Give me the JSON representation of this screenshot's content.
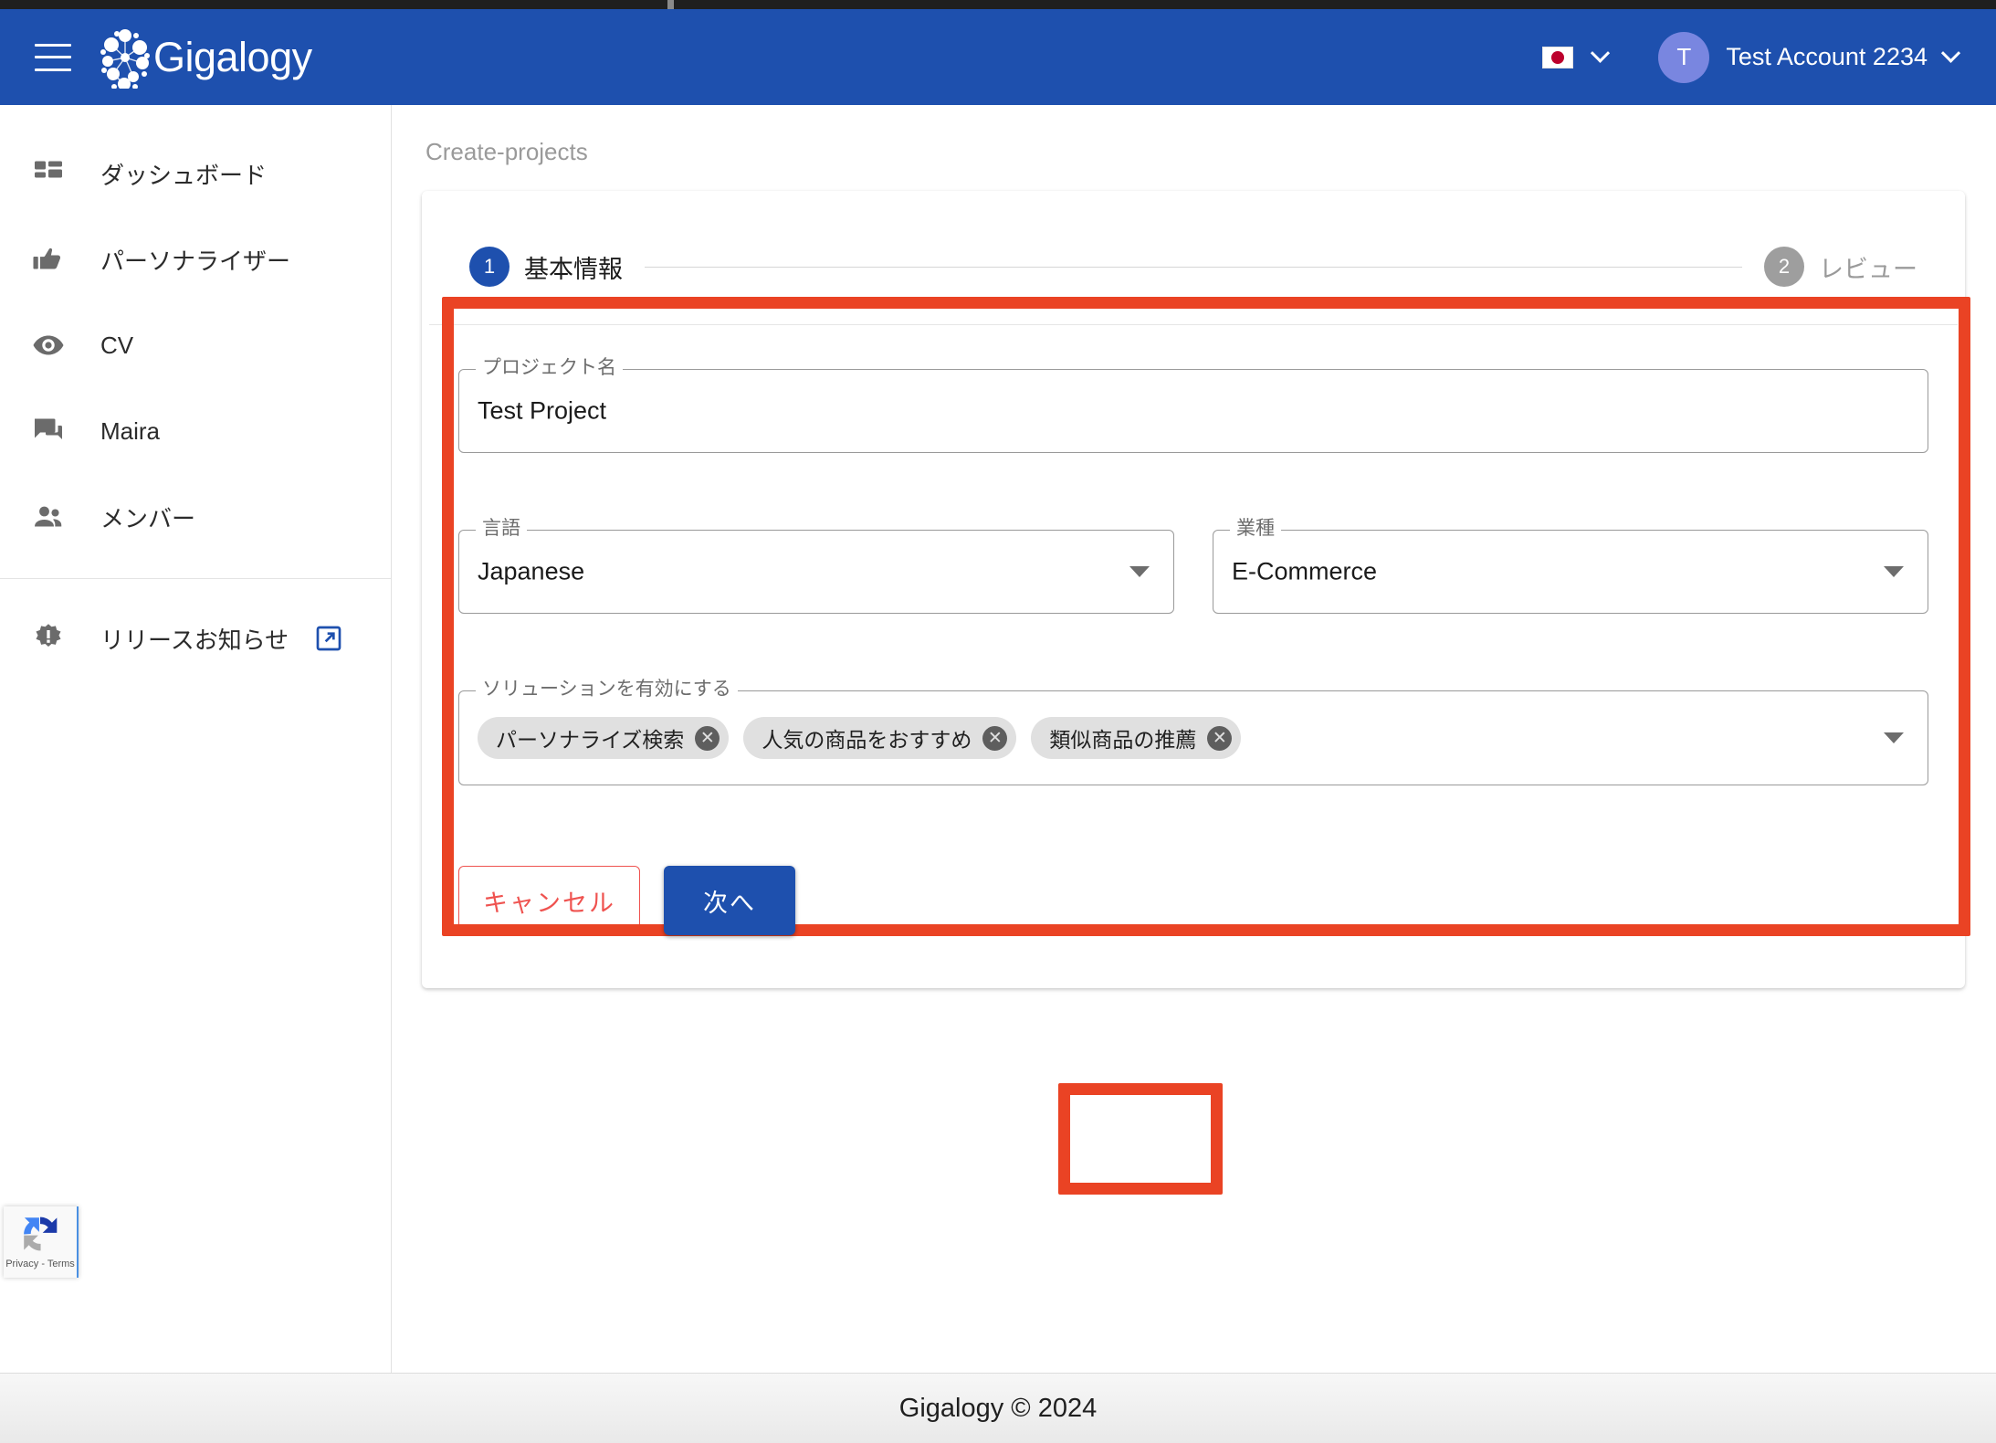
{
  "header": {
    "menu_icon": "hamburger-menu-icon",
    "brand_name": "Gigalogy",
    "language_flag": "japan-flag-icon",
    "account_initial": "T",
    "account_name": "Test Account 2234"
  },
  "sidebar": {
    "items": [
      {
        "label": "ダッシュボード",
        "icon": "dashboard-icon"
      },
      {
        "label": "パーソナライザー",
        "icon": "thumb-up-icon"
      },
      {
        "label": "CV",
        "icon": "eye-icon"
      },
      {
        "label": "Maira",
        "icon": "chat-bubble-icon"
      },
      {
        "label": "メンバー",
        "icon": "people-icon"
      }
    ],
    "footer_item": {
      "label": "リリースお知らせ",
      "icon": "new-release-icon",
      "external_icon": "open-in-new-icon"
    }
  },
  "recaptcha": {
    "text": "Privacy - Terms",
    "icon": "recaptcha-logo-icon"
  },
  "main": {
    "breadcrumb": "Create-projects",
    "stepper": {
      "steps": [
        {
          "number": "1",
          "label": "基本情報",
          "state": "active"
        },
        {
          "number": "2",
          "label": "レビュー",
          "state": "inactive"
        }
      ]
    },
    "form": {
      "project_name": {
        "legend": "プロジェクト名",
        "value": "Test Project"
      },
      "language": {
        "legend": "言語",
        "value": "Japanese",
        "caret_icon": "dropdown-caret-icon"
      },
      "industry": {
        "legend": "業種",
        "value": "E-Commerce",
        "caret_icon": "dropdown-caret-icon"
      },
      "solutions": {
        "legend": "ソリューションを有効にする",
        "caret_icon": "dropdown-caret-icon",
        "chips": [
          {
            "label": "パーソナライズ検索",
            "remove_icon": "chip-remove-icon",
            "remove_glyph": "✕"
          },
          {
            "label": "人気の商品をおすすめ",
            "remove_icon": "chip-remove-icon",
            "remove_glyph": "✕"
          },
          {
            "label": "類似商品の推薦",
            "remove_icon": "chip-remove-icon",
            "remove_glyph": "✕"
          }
        ]
      }
    },
    "actions": {
      "cancel_label": "キャンセル",
      "next_label": "次へ"
    }
  },
  "footer": {
    "text": "Gigalogy © 2024"
  },
  "colors": {
    "brand_blue": "#1e50ae",
    "highlight_red": "#ea4324",
    "cancel_red": "#ef5350",
    "avatar_purple": "#7986e0",
    "step_inactive_gray": "#9e9e9e",
    "chip_gray": "#e0e0e0"
  }
}
